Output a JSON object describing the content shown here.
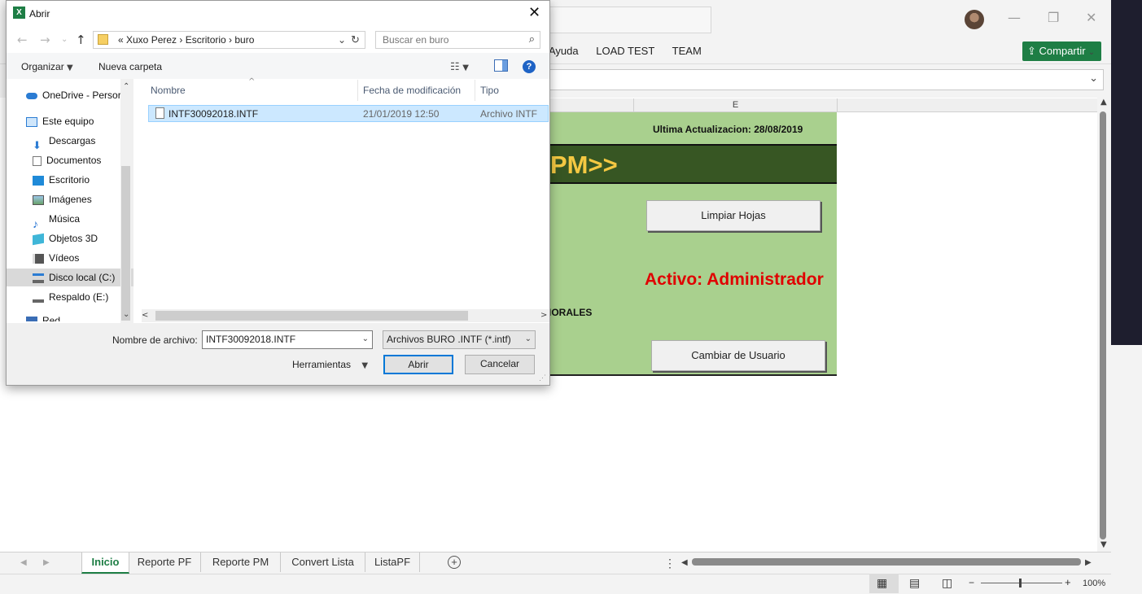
{
  "excel": {
    "menu": [
      "Ayuda",
      "LOAD TEST",
      "TEAM"
    ],
    "share_label": "Compartir",
    "column_e": "E",
    "update_label": "Ultima Actualizacion: 28/08/2019",
    "banner_text": "PM>>",
    "clear_button": "Limpiar Hojas",
    "active_user": "Activo: Administrador",
    "partial_text": "IORALES",
    "change_user_button": "Cambiar de Usuario",
    "sheet_tabs": [
      "Inicio",
      "Reporte PF",
      "Reporte PM",
      "Convert Lista",
      "ListaPF"
    ],
    "active_tab": "Inicio",
    "zoom": "100%",
    "icons": [
      "minimize-icon",
      "restore-icon",
      "close-icon",
      "add-sheet-icon",
      "normal-view-icon",
      "page-layout-icon",
      "page-break-icon"
    ]
  },
  "dialog": {
    "title": "Abrir",
    "breadcrumb": "«  Xuxo Perez  ›  Escritorio  ›  buro",
    "search_placeholder": "Buscar en buro",
    "organize": "Organizar",
    "new_folder": "Nueva carpeta",
    "nav_items": [
      {
        "label": "OneDrive - Persor"
      },
      {
        "label": "Este equipo"
      },
      {
        "label": "Descargas"
      },
      {
        "label": "Documentos"
      },
      {
        "label": "Escritorio"
      },
      {
        "label": "Imágenes"
      },
      {
        "label": "Música"
      },
      {
        "label": "Objetos 3D"
      },
      {
        "label": "Vídeos"
      },
      {
        "label": "Disco local (C:)"
      },
      {
        "label": "Respaldo (E:)"
      },
      {
        "label": "Red"
      }
    ],
    "columns": [
      "Nombre",
      "Fecha de modificación",
      "Tipo"
    ],
    "files": [
      {
        "name": "INTF30092018.INTF",
        "modified": "21/01/2019 12:50",
        "type": "Archivo INTF"
      }
    ],
    "filename_label": "Nombre de archivo:",
    "filename_value": "INTF30092018.INTF",
    "filetype": "Archivos BURO .INTF (*.intf)",
    "tools": "Herramientas",
    "open": "Abrir",
    "cancel": "Cancelar"
  }
}
